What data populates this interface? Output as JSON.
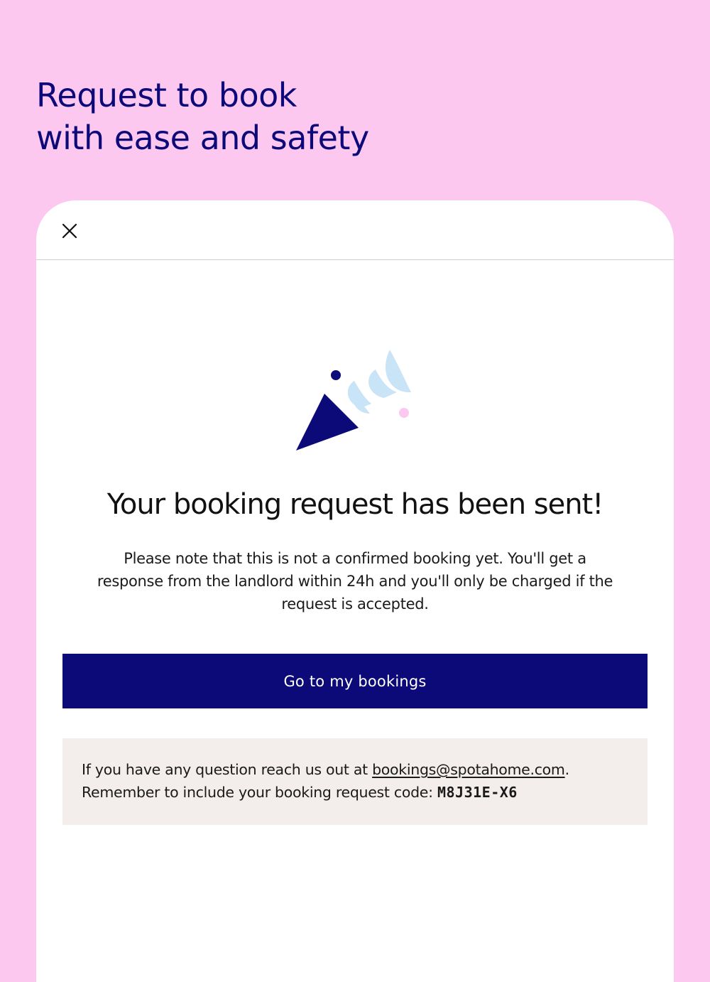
{
  "promo": {
    "title_line1": "Request to book",
    "title_line2": "with ease and safety"
  },
  "dialog": {
    "close_icon": "close-icon",
    "illustration": "party-popper-icon",
    "headline": "Your booking request has been sent!",
    "body": "Please note that this is not a confirmed booking yet. You'll get a response from the landlord within 24h and you'll only be charged if the request is accepted.",
    "primary_button": "Go to my bookings",
    "info": {
      "line1_prefix": "If you have any question reach us out at ",
      "email": "bookings@spotahome.com",
      "line1_suffix": ".",
      "line2_prefix": "Remember to include your booking request code: ",
      "code": "M8J31E-X6"
    }
  },
  "colors": {
    "background": "#fdc8ef",
    "brand_navy": "#0b0a78",
    "light_blue": "#c9e3f7",
    "info_box_bg": "#f3eeeb",
    "accent_pink": "#fdc8ef"
  }
}
